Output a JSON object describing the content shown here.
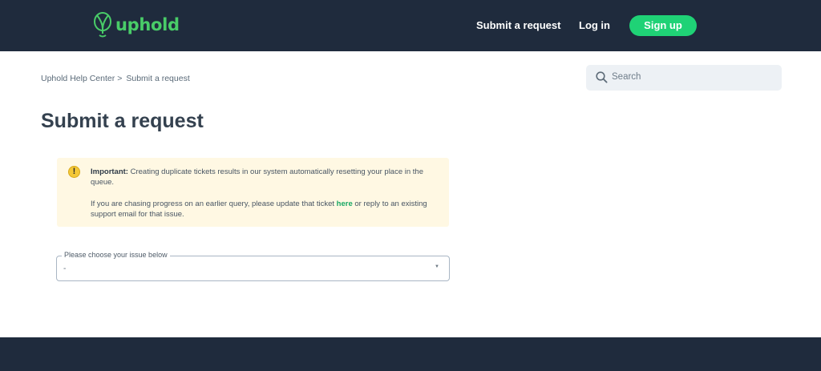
{
  "header": {
    "logo_text": "uphold",
    "nav": {
      "submit_request": "Submit a request",
      "log_in": "Log in",
      "sign_up": "Sign up"
    }
  },
  "breadcrumb": {
    "home": "Uphold Help Center",
    "separator": ">",
    "current": "Submit a request"
  },
  "search": {
    "placeholder": "Search",
    "icon": "search-icon"
  },
  "page": {
    "title": "Submit a request"
  },
  "notice": {
    "icon": "warning-icon",
    "icon_glyph": "!",
    "important_label": "Important:",
    "text1": " Creating duplicate tickets results in our system automatically resetting your place in the queue.",
    "text2_before": "If you are chasing progress on an earlier query, please update that ticket ",
    "link_text": "here",
    "text2_after": " or reply to an existing support email for that issue."
  },
  "issue_select": {
    "label": "Please choose your issue below",
    "value": "-",
    "caret": "▼"
  },
  "colors": {
    "header_bg": "#1f2b3d",
    "brand_green": "#49cc68",
    "signup_bg": "#1fd276",
    "notice_bg": "#fff8e3",
    "link_green": "#18a864"
  }
}
